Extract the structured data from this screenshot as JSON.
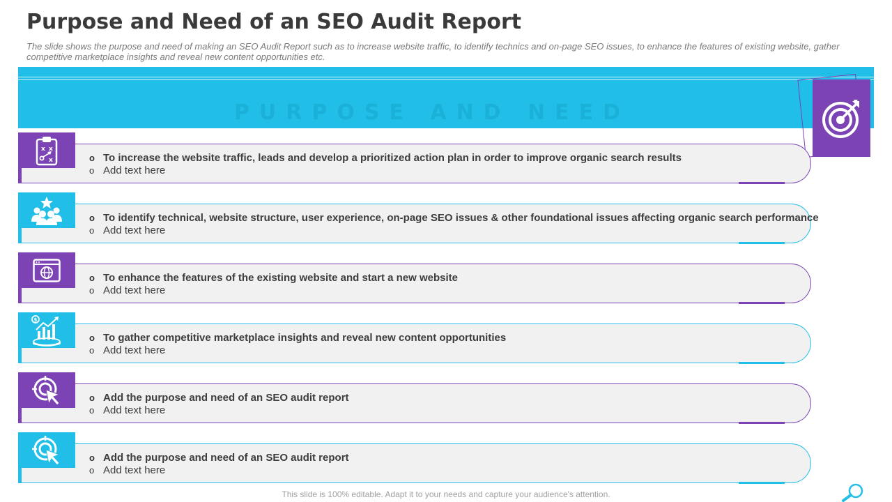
{
  "title": "Purpose and Need of an SEO Audit Report",
  "subtitle": "The slide shows the purpose and need of making an SEO Audit Report such as to increase website traffic, to identify technics and on-page SEO issues, to enhance the features of existing website, gather competitive marketplace insights and reveal new content opportunities etc.",
  "banner_text": "PURPOSE AND NEED",
  "bullet_char": "o",
  "rows": [
    {
      "icon": "strategy-clipboard-icon",
      "main": "To increase the website traffic, leads and develop a prioritized action plan in order to improve organic search results",
      "sub": "Add text here"
    },
    {
      "icon": "team-star-icon",
      "main": "To identify technical, website structure, user experience, on-page SEO issues & other foundational issues affecting organic search performance",
      "sub": "Add text here"
    },
    {
      "icon": "web-browser-globe-icon",
      "main": "To enhance the features of the existing website and start a new website",
      "sub": "Add text here"
    },
    {
      "icon": "market-growth-chart-icon",
      "main": "To gather competitive marketplace insights and reveal new content opportunities",
      "sub": "Add text here"
    },
    {
      "icon": "target-cursor-icon",
      "main": "Add  the purpose and need of an SEO audit report",
      "sub": "Add text here"
    },
    {
      "icon": "target-cursor-icon",
      "main": "Add  the purpose and need of an SEO audit report",
      "sub": "Add text here"
    }
  ],
  "footer": "This slide is 100% editable. Adapt it to your needs and capture your audience's attention.",
  "colors": {
    "purple": "#7b43b3",
    "cyan": "#21bfe7",
    "pill": "#f1f1f1"
  }
}
